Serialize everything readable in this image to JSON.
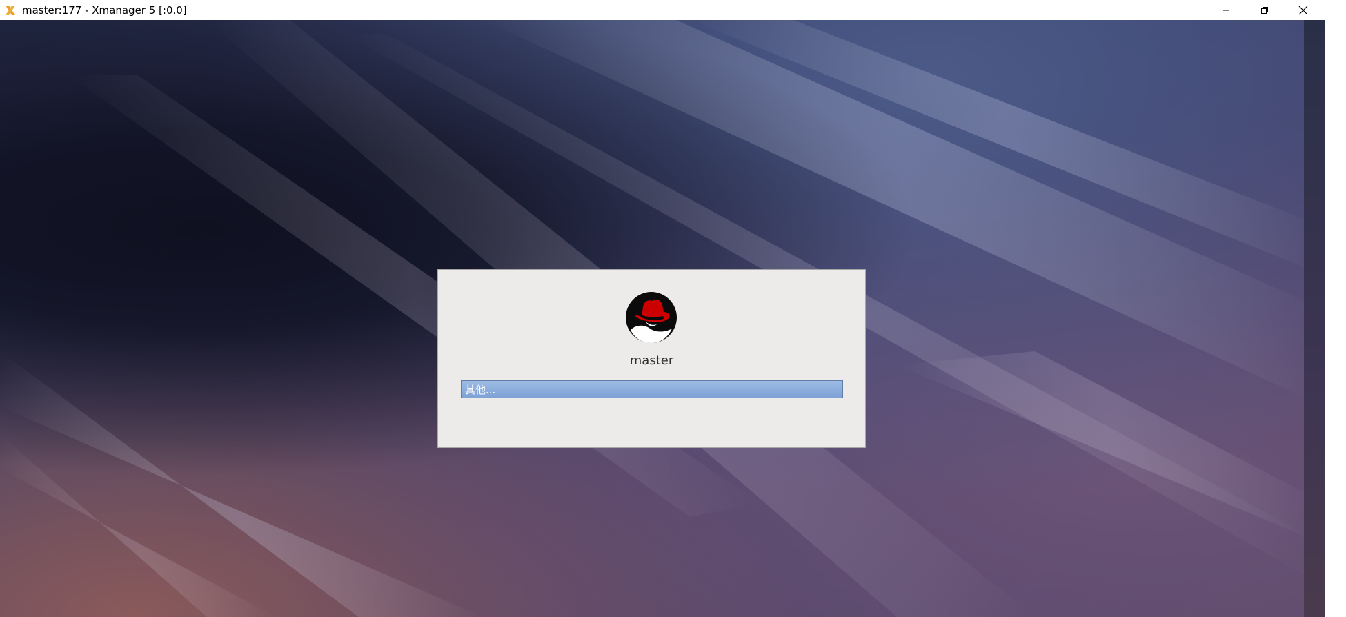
{
  "window": {
    "title": "master:177 - Xmanager 5 [:0.0]",
    "app_icon": "xmanager-x-icon",
    "controls": {
      "minimize_icon": "minimize-icon",
      "restore_icon": "restore-icon",
      "close_icon": "close-icon"
    }
  },
  "greeter": {
    "logo_icon": "redhat-logo-icon",
    "hostname": "master",
    "users": [
      {
        "label": "其他...",
        "selected": true
      }
    ]
  },
  "colors": {
    "dialog_bg": "#edebe9",
    "selection": "#8aaee0",
    "redhat_red": "#cc0000"
  }
}
